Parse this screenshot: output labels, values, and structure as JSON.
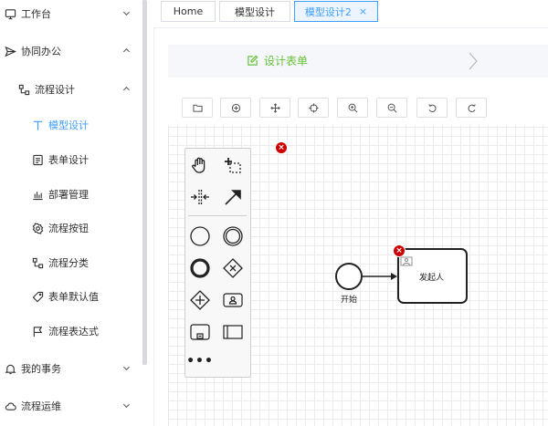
{
  "sidebar": {
    "items": [
      {
        "label": "工作台",
        "icon": "monitor-icon",
        "chevron": "down"
      },
      {
        "label": "协同办公",
        "icon": "send-icon",
        "chevron": "up"
      },
      {
        "label": "流程设计",
        "icon": "flow-icon",
        "chevron": "up"
      },
      {
        "label": "模型设计",
        "icon": "text-t-icon",
        "active": true
      },
      {
        "label": "表单设计",
        "icon": "form-icon"
      },
      {
        "label": "部署管理",
        "icon": "bar-chart-icon"
      },
      {
        "label": "流程按钮",
        "icon": "gear-icon"
      },
      {
        "label": "流程分类",
        "icon": "flow-icon"
      },
      {
        "label": "表单默认值",
        "icon": "tag-icon"
      },
      {
        "label": "流程表达式",
        "icon": "flag-icon"
      },
      {
        "label": "我的事务",
        "icon": "bell-icon",
        "chevron": "down"
      },
      {
        "label": "流程运维",
        "icon": "cloud-icon",
        "chevron": "down"
      }
    ]
  },
  "tabs": [
    {
      "label": "Home"
    },
    {
      "label": "模型设计"
    },
    {
      "label": "模型设计2",
      "close": "×",
      "active": true
    }
  ],
  "step": {
    "label": "设计表单"
  },
  "toolbar": {
    "buttons": [
      "folder-icon",
      "target-plus-icon",
      "move-icon",
      "crosshair-icon",
      "zoom-in-icon",
      "zoom-out-icon",
      "undo-icon",
      "redo-icon"
    ]
  },
  "palette": {
    "tools": [
      "hand-tool-icon",
      "lasso-tool-icon",
      "space-tool-icon",
      "connect-tool-icon",
      "start-event-icon",
      "intermediate-event-icon",
      "end-event-icon",
      "gateway-icon",
      "parallel-gateway-icon",
      "user-task-icon",
      "subprocess-icon",
      "pool-icon"
    ],
    "more": "•••"
  },
  "diagram": {
    "start_label": "开始",
    "task_label": "发起人",
    "error_mark": "×"
  },
  "colors": {
    "accent": "#409eff",
    "step": "#67c23a",
    "error": "#cc0000"
  }
}
